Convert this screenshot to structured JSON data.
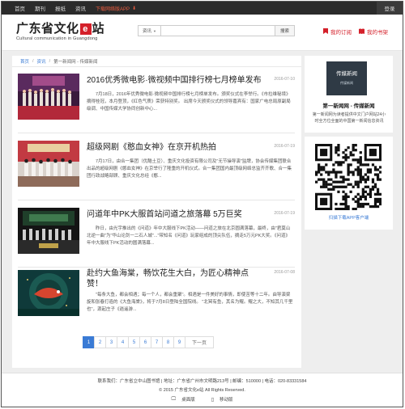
{
  "topbar": {
    "nav": [
      "首页",
      "期刊",
      "报纸",
      "资讯"
    ],
    "app_download": "下载网络版APP",
    "login": "登录"
  },
  "header": {
    "logo_prefix": "广东省文化",
    "logo_mark": "e",
    "logo_suffix": "站",
    "logo_sub": "Cultural communication in Guangdong",
    "search_type": "资讯",
    "search_value": "",
    "search_button": "搜索",
    "my_subscriptions": "我的订阅",
    "my_bookshelf": "我的书架"
  },
  "breadcrumb": {
    "home": "首页",
    "news": "资讯",
    "current": "第一新闻网 - 传媒新闻"
  },
  "articles": [
    {
      "title": "2016优秀微电影·微视频中国排行榜七月榜单发布",
      "date": "2016-07-10",
      "summary": "7月18日，2016年优秀微电影·微视频中国排行榜七月榜单发布。颁奖仪式在李举行。《市拉维秘境》摘得桂冠，本月登顶，《红色气质》荣获特别奖。 出席今天颁奖仪式的领导嘉宾有：国家广电总局原副局级调、中国传媒大学协同创新中心..."
    },
    {
      "title": "超级网剧《憨血女神》在京开机热拍",
      "date": "2016-07-19",
      "summary": "7月17日，由合一集团（优酷土豆）、重庆文化投资有限公司及\"无节操导演\"监牌，协会传媒集团联合出品的超级网剧《憨血女神》在京举行了隆重的开机仪式。合一集团国内最顶级网络总监齐齐歌、合一集团行政战略部顾、重庆文化总经《憨..."
    },
    {
      "title": "问道年中PK大服首站问道之旅落幕 5万巨奖",
      "date": "2016-07-19",
      "summary": "昨日，由光宇推出的《问道》年中大服线下PK活动——问道之旅在北京圆满落幕，最终，由\"君莫山北逆一曲\"为\"华山论剑一二石人城\"...\"带知名《问道》玩家组成的顶尖队伍，摘走5万元PK大奖。《问道》年中大服线下PK活动的圆满落幕..."
    },
    {
      "title": "赴约大鱼海棠，畅饮花生大白，为匠心精神点赞！",
      "date": "2016-07-08",
      "summary": "\"每条大鱼，都会相遇；每一个人，都会重聚\"。相遇是一件美好的事情，即使苦等十二年。由导演梁旋和张春打造的《大鱼海棠》，将于7月8日登陆全国院线。 \"北冥有鱼，其名为鲲。鲲之大，不知其几千里也\"，源起庄子《逍遥游..."
    }
  ],
  "pagination": {
    "pages": [
      "1",
      "2",
      "3",
      "4",
      "5",
      "6",
      "7",
      "8",
      "9"
    ],
    "current": "1",
    "next": "下一页"
  },
  "sidebar": {
    "card_img_title": "传媒新闻",
    "card_img_sub": "传媒新闻",
    "card_name": "第一新闻网 - 传媒新闻",
    "card_desc": "第一新闻网为读者提供中文门户网站24小时全方位全面的中国第一新闻信息资讯",
    "qr_caption": "扫描下载APP客户端"
  },
  "footer": {
    "contact": "联系我们：广东省立中山图书馆 | 地址：广东省广州市文明路213号 | 邮编：510000 | 电话：020-83331584",
    "copyright": "© 2015 广东省文化e站 All Rights Reserved.",
    "desktop": "桌面版",
    "mobile": "移动版"
  },
  "colors": {
    "accent_red": "#d4202a",
    "link_blue": "#3a7bd5",
    "topbar_bg": "#2b2b2b"
  }
}
